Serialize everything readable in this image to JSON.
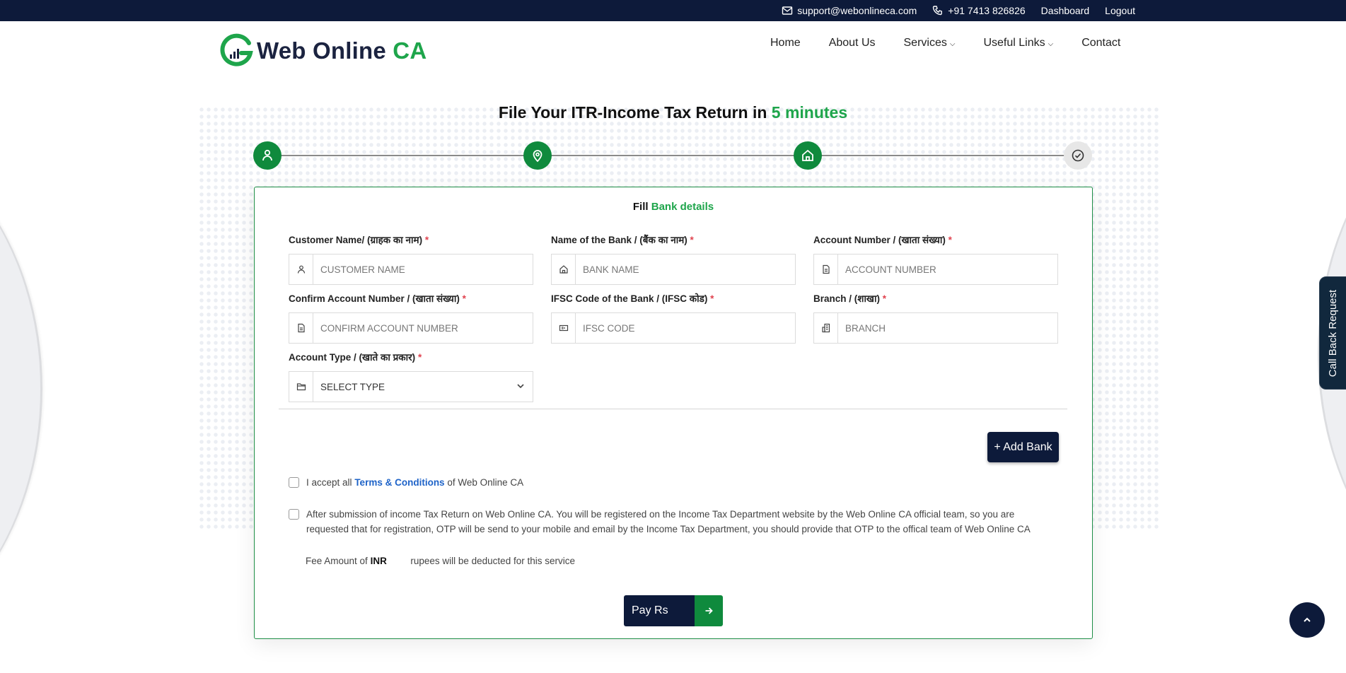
{
  "topbar": {
    "email": "support@webonlineca.com",
    "phone": "+91 7413 826826",
    "dashboard": "Dashboard",
    "logout": "Logout"
  },
  "brand": {
    "name_main": "Web Online",
    "name_accent": "CA"
  },
  "nav": [
    {
      "label": "Home",
      "dropdown": false
    },
    {
      "label": "About Us",
      "dropdown": false
    },
    {
      "label": "Services",
      "dropdown": true
    },
    {
      "label": "Useful Links",
      "dropdown": true
    },
    {
      "label": "Contact",
      "dropdown": false
    }
  ],
  "title": {
    "main": "File Your ITR-Income Tax Return in",
    "highlight": "5 minutes"
  },
  "stepper": {
    "steps": [
      {
        "icon": "user-icon",
        "state": "complete"
      },
      {
        "icon": "location-pin-icon",
        "state": "complete"
      },
      {
        "icon": "home-icon",
        "state": "complete"
      },
      {
        "icon": "check-circle-icon",
        "state": "pending"
      }
    ]
  },
  "form": {
    "heading_prefix": "Fill",
    "heading_highlight": "Bank details",
    "fields": {
      "customer_name": {
        "label": "Customer Name/ (ग्राहक का नाम)",
        "required": "*",
        "placeholder": "CUSTOMER NAME",
        "value": ""
      },
      "bank_name": {
        "label": "Name of the Bank / (बैंक का नाम)",
        "required": "*",
        "placeholder": "BANK NAME",
        "value": ""
      },
      "account_number": {
        "label": "Account Number / (खाता संख्या)",
        "required": "*",
        "placeholder": "ACCOUNT NUMBER",
        "value": ""
      },
      "confirm_account_number": {
        "label": "Confirm Account Number / (खाता संख्या)",
        "required": "*",
        "placeholder": "CONFIRM ACCOUNT NUMBER",
        "value": ""
      },
      "ifsc_code": {
        "label": "IFSC Code of the Bank / (IFSC कोड)",
        "required": "*",
        "placeholder": "IFSC CODE",
        "value": ""
      },
      "branch": {
        "label": "Branch / (शाखा)",
        "required": "*",
        "placeholder": "BRANCH",
        "value": ""
      },
      "account_type": {
        "label": "Account Type / (खाते का प्रकार)",
        "required": "*",
        "selected": "SELECT TYPE"
      }
    },
    "add_bank_label": "+ Add Bank",
    "terms": {
      "prefix": "I accept all",
      "link": "Terms & Conditions",
      "suffix": "of Web Online CA"
    },
    "otp_notice": "After submission of income Tax Return on Web Online CA. You will be registered on the Income Tax Department website by the Web Online CA official team, so you are requested that for registration, OTP will be send to your mobile and email by the Income Tax Department, you should provide that OTP to the offical team of Web Online CA",
    "fee": {
      "prefix": "Fee Amount of",
      "currency": "INR",
      "amount": "",
      "suffix": "rupees will be deducted for this service"
    },
    "pay_label": "Pay Rs"
  },
  "callback_label": "Call Back Request",
  "colors": {
    "navy": "#0d1a3a",
    "green": "#0f8a3d",
    "accent_green": "#1ea54b",
    "link_blue": "#1e63c8",
    "required_red": "#e0434f"
  }
}
